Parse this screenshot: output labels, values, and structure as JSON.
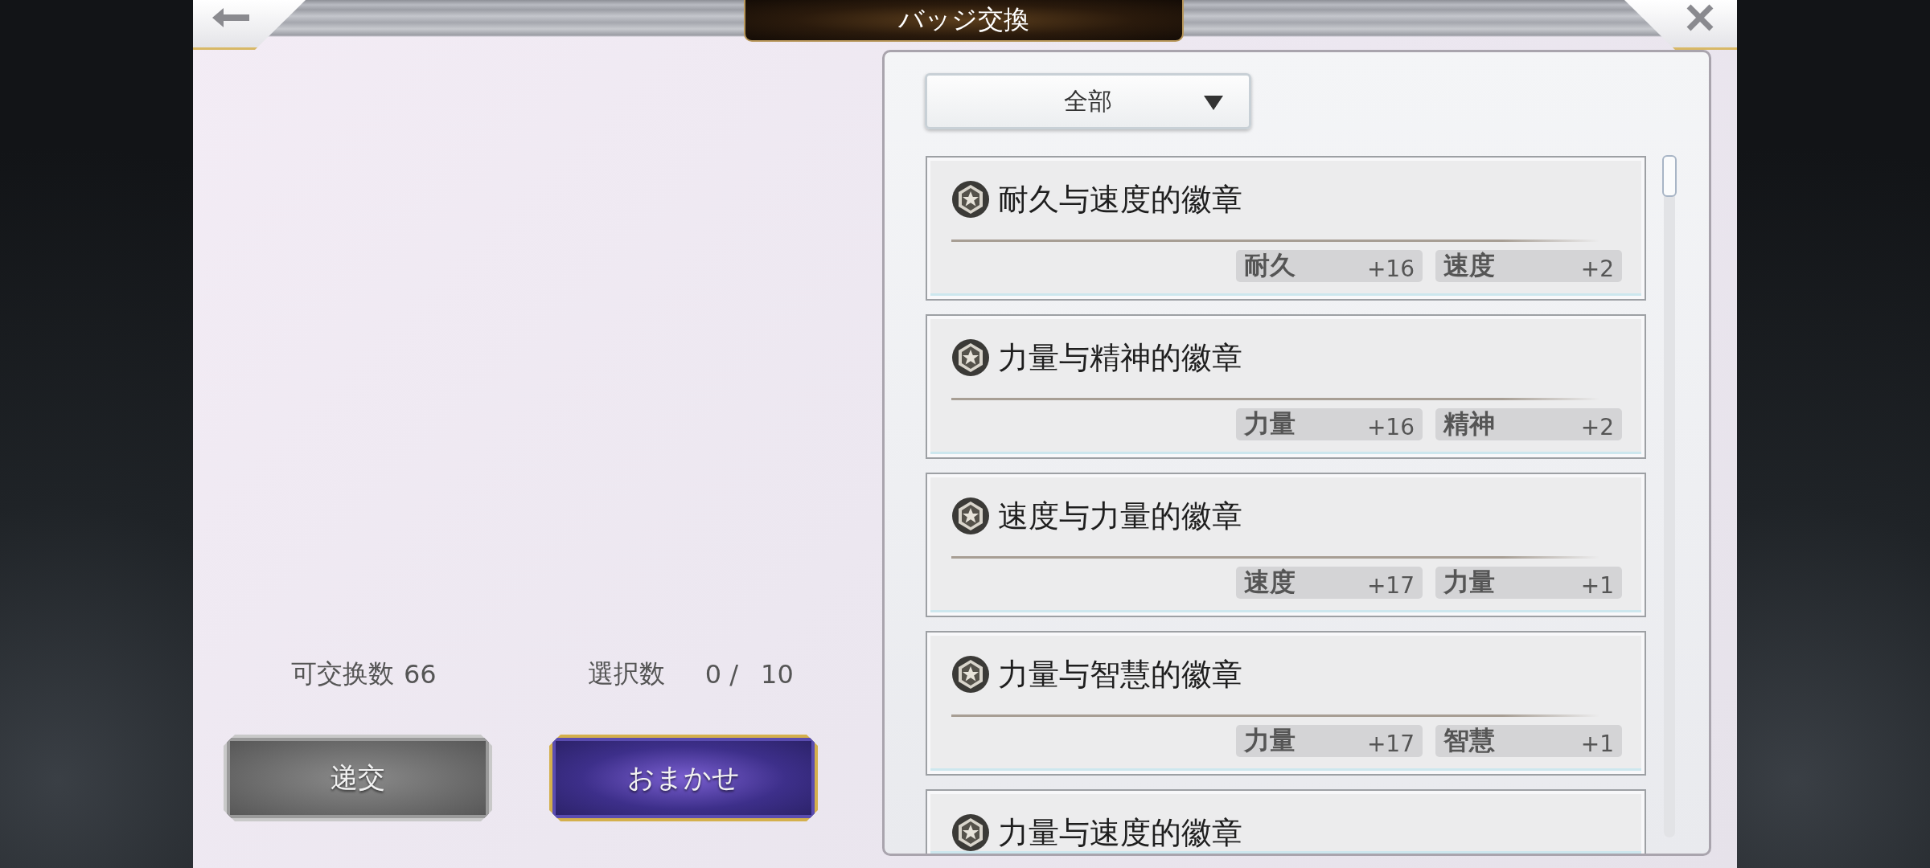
{
  "header": {
    "title": "バッジ交換"
  },
  "summary": {
    "exchangeable_label": "可交换数",
    "exchangeable_value": "66",
    "selected_label": "選択数",
    "selected_value": "0 /",
    "selected_max": "10"
  },
  "buttons": [
    {
      "label": "递交",
      "disabled": true
    },
    {
      "label": "おまかせ",
      "disabled": false
    }
  ],
  "filter": {
    "value": "全部"
  },
  "badges": [
    {
      "name": "耐久与速度的徽章",
      "stats": [
        {
          "label": "耐久",
          "value": "+16"
        },
        {
          "label": "速度",
          "value": "+2"
        }
      ]
    },
    {
      "name": "力量与精神的徽章",
      "stats": [
        {
          "label": "力量",
          "value": "+16"
        },
        {
          "label": "精神",
          "value": "+2"
        }
      ]
    },
    {
      "name": "速度与力量的徽章",
      "stats": [
        {
          "label": "速度",
          "value": "+17"
        },
        {
          "label": "力量",
          "value": "+1"
        }
      ]
    },
    {
      "name": "力量与智慧的徽章",
      "stats": [
        {
          "label": "力量",
          "value": "+17"
        },
        {
          "label": "智慧",
          "value": "+1"
        }
      ]
    },
    {
      "name": "力量与速度的徽章"
    }
  ]
}
